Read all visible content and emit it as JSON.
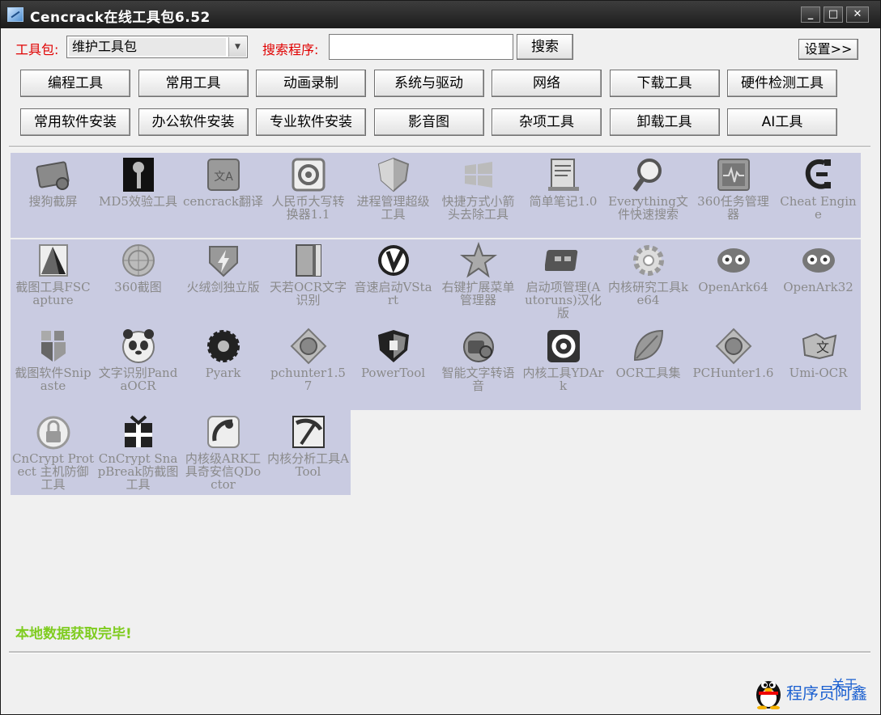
{
  "window": {
    "title": "Cencrack在线工具包6.52",
    "min": "_",
    "max": "□",
    "close": "✕"
  },
  "toolbar": {
    "toolkit_label": "工具包:",
    "toolkit_value": "维护工具包",
    "search_label": "搜索程序:",
    "search_value": "",
    "search_button": "搜索",
    "settings_button": "设置>>"
  },
  "categories_row1": [
    "编程工具",
    "常用工具",
    "动画录制",
    "系统与驱动",
    "网络",
    "下载工具",
    "硬件检测工具"
  ],
  "categories_row2": [
    "常用软件安装",
    "办公软件安装",
    "专业软件安装",
    "影音图",
    "杂项工具",
    "卸载工具",
    "AI工具"
  ],
  "tools": [
    {
      "name": "搜狗截屏",
      "icon": "screenshot-tool-icon"
    },
    {
      "name": "MD5效验工具",
      "icon": "key-icon"
    },
    {
      "name": "cencrack翻译",
      "icon": "translate-icon"
    },
    {
      "name": "人民币大写转换器1.1",
      "icon": "converter-icon"
    },
    {
      "name": "进程管理超级工具",
      "icon": "shield-icon"
    },
    {
      "name": "快捷方式小箭头去除工具",
      "icon": "windows-icon"
    },
    {
      "name": "简单笔记1.0",
      "icon": "notepad-icon"
    },
    {
      "name": "Everything文件快速搜索",
      "icon": "magnifier-icon"
    },
    {
      "name": "360任务管理器",
      "icon": "task-monitor-icon"
    },
    {
      "name": "Cheat Engine",
      "icon": "cheat-engine-icon"
    },
    {
      "name": "截图工具FSCapture",
      "icon": "capture-icon"
    },
    {
      "name": "360截图",
      "icon": "target-icon"
    },
    {
      "name": "火绒剑独立版",
      "icon": "sword-shield-icon"
    },
    {
      "name": "天若OCR文字识别",
      "icon": "book-icon"
    },
    {
      "name": "音速启动VStart",
      "icon": "vstart-icon"
    },
    {
      "name": "右键扩展菜单管理器",
      "icon": "star-icon"
    },
    {
      "name": "启动项管理(Autoruns)汉化版",
      "icon": "autoruns-icon"
    },
    {
      "name": "内核研究工具ke64",
      "icon": "gear-icon"
    },
    {
      "name": "OpenArk64",
      "icon": "openark-icon"
    },
    {
      "name": "OpenArk32",
      "icon": "openark-icon"
    },
    {
      "name": "截图软件Snipaste",
      "icon": "snipaste-icon"
    },
    {
      "name": "文字识别PandaOCR",
      "icon": "panda-icon"
    },
    {
      "name": "Pyark",
      "icon": "flower-gear-icon"
    },
    {
      "name": "pchunter1.57",
      "icon": "pchunter-icon"
    },
    {
      "name": "PowerTool",
      "icon": "power-shield-icon"
    },
    {
      "name": "智能文字转语音",
      "icon": "speech-icon"
    },
    {
      "name": "内核工具YDArk",
      "icon": "ydark-icon"
    },
    {
      "name": "OCR工具集",
      "icon": "leaf-icon"
    },
    {
      "name": "PCHunter1.6",
      "icon": "pchunter-icon"
    },
    {
      "name": "Umi-OCR",
      "icon": "umi-ocr-icon"
    },
    {
      "name": "CnCrypt Protect 主机防御工具",
      "icon": "lock-icon"
    },
    {
      "name": "CnCrypt SnapBreak防截图工具",
      "icon": "gift-icon"
    },
    {
      "name": "内核级ARK工具奇安信QDoctor",
      "icon": "qdoctor-icon"
    },
    {
      "name": "内核分析工具ATool",
      "icon": "pickaxe-icon"
    }
  ],
  "status": "本地数据获取完毕!",
  "footer": {
    "link": "程序员阿鑫",
    "about": "关于"
  }
}
